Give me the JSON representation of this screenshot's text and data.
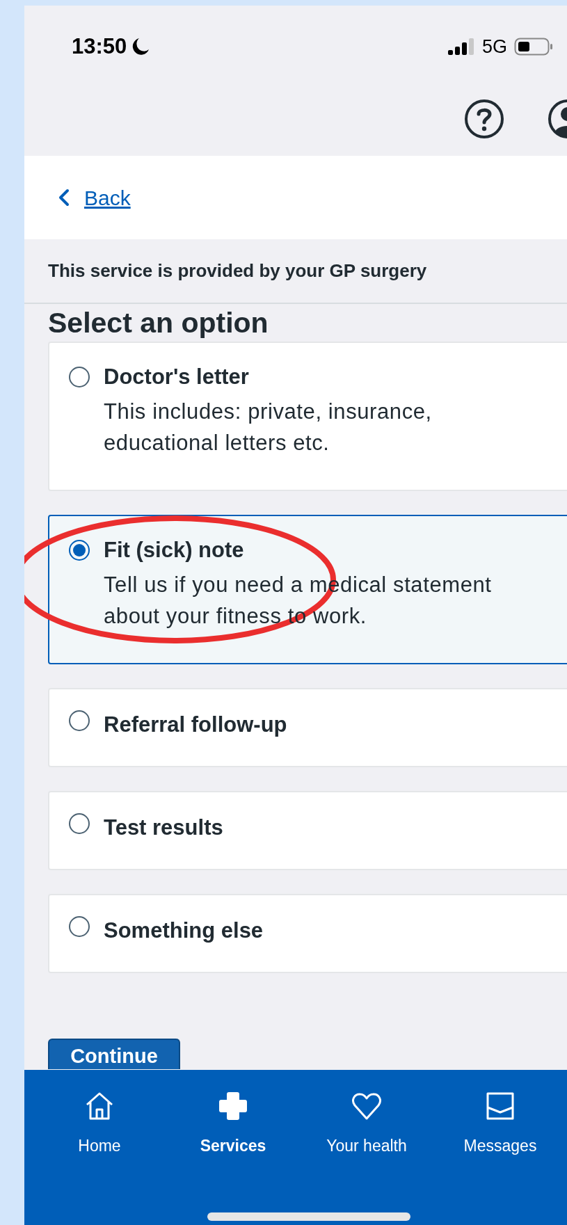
{
  "status_bar": {
    "time": "13:50",
    "network": "5G"
  },
  "back_link": "Back",
  "service_note": "This service is provided by your GP surgery",
  "heading": "Select an option",
  "options": [
    {
      "title": "Doctor's letter",
      "description": "This includes: private, insurance, educational letters etc.",
      "selected": false
    },
    {
      "title": "Fit (sick) note",
      "description": "Tell us if you need a medical statement about your fitness to work.",
      "selected": true
    },
    {
      "title": "Referral follow-up",
      "selected": false
    },
    {
      "title": "Test results",
      "selected": false
    },
    {
      "title": "Something else",
      "selected": false
    }
  ],
  "continue_button": "Continue",
  "nav": [
    {
      "kind": "home",
      "label": "Home",
      "selected": false
    },
    {
      "kind": "services",
      "label": "Services",
      "selected": true
    },
    {
      "kind": "health",
      "label": "Your health",
      "selected": false
    },
    {
      "kind": "messages",
      "label": "Messages",
      "selected": false
    }
  ]
}
